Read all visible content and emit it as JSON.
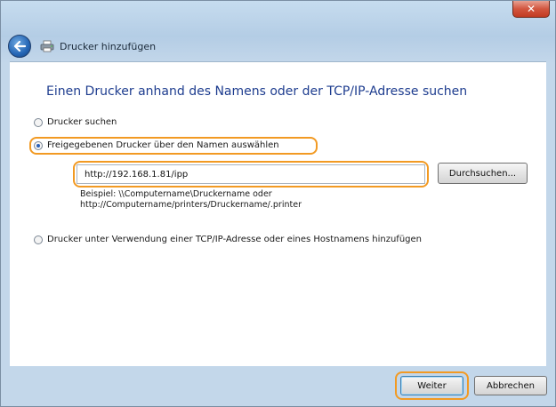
{
  "window": {
    "title": "Drucker hinzufügen",
    "close_glyph": "✕"
  },
  "main": {
    "heading": "Einen Drucker anhand des Namens oder der TCP/IP-Adresse suchen",
    "options": [
      {
        "label": "Drucker suchen",
        "checked": false
      },
      {
        "label": "Freigegebenen Drucker über den Namen auswählen",
        "checked": true
      },
      {
        "label": "Drucker unter Verwendung einer TCP/IP-Adresse oder eines Hostnamens hinzufügen",
        "checked": false
      }
    ],
    "printer_url": "http://192.168.1.81/ipp",
    "browse_label": "Durchsuchen...",
    "example_line1": "Beispiel: \\\\Computername\\Druckername oder",
    "example_line2": "http://Computername/printers/Druckername/.printer"
  },
  "footer": {
    "next_label": "Weiter",
    "cancel_label": "Abbrechen"
  },
  "colors": {
    "highlight": "#f29a23",
    "heading": "#1e3d8f"
  },
  "icons": {
    "back": "back-arrow-icon",
    "printer": "printer-icon",
    "close": "close-icon"
  }
}
